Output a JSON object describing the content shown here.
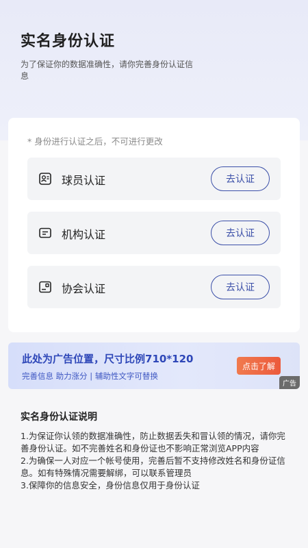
{
  "header": {
    "title": "实名身份认证",
    "subtitle": "为了保证你的数据准确性，请你完善身份认证信息"
  },
  "card": {
    "note": "* 身份进行认证之后，不可进行更改",
    "items": [
      {
        "label": "球员认证",
        "button": "去认证",
        "icon": "player-id-icon"
      },
      {
        "label": "机构认证",
        "button": "去认证",
        "icon": "institution-card-icon"
      },
      {
        "label": "协会认证",
        "button": "去认证",
        "icon": "association-icon"
      }
    ]
  },
  "ad": {
    "title": "此处为广告位置，尺寸比例710*120",
    "subtitle": "完善信息 助力涨分 | 辅助性文字可替换",
    "cta": "点击了解",
    "tag": "广告"
  },
  "explanation": {
    "title": "实名身份认证说明",
    "items": [
      "1.为保证你认领的数据准确性，防止数据丢失和冒认领的情况，请你完善身份认证。如不完善姓名和身份证也不影响正常浏览APP内容",
      "2.为确保一人对应一个帐号使用，完善后暂不支持修改姓名和身份证信息。如有特殊情况需要解绑，可以联系管理员",
      "3.保障你的信息安全，身份信息仅用于身份认证"
    ]
  },
  "colors": {
    "accent": "#3b4fa8",
    "ad_title": "#2e47b8",
    "cta": "#ec5a3c"
  }
}
